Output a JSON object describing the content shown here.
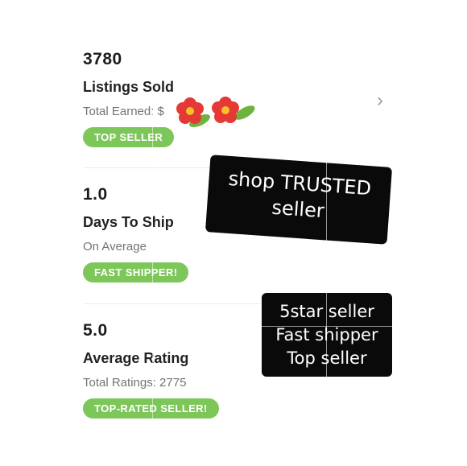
{
  "stats": [
    {
      "value": "3780",
      "label": "Listings Sold",
      "sub": "Total Earned: $",
      "badge": "TOP SELLER"
    },
    {
      "value": "1.0",
      "label": "Days To Ship",
      "sub": "On Average",
      "badge": "FAST SHIPPER!"
    },
    {
      "value": "5.0",
      "label": "Average Rating",
      "sub": "Total Ratings: 2775",
      "badge": "TOP-RATED SELLER!"
    }
  ],
  "stickers": {
    "trusted": [
      "shop TRUSTED",
      "seller"
    ],
    "summary": [
      "5star seller",
      "Fast shipper",
      "Top seller"
    ]
  },
  "colors": {
    "badge": "#7dc75a",
    "sticker": "#0a0a0a",
    "flower": "#e53935",
    "leaf": "#6fb33f"
  },
  "icons": {
    "row_arrow": "chevron-right-icon",
    "sticker_emoji": "flower-emoji"
  }
}
